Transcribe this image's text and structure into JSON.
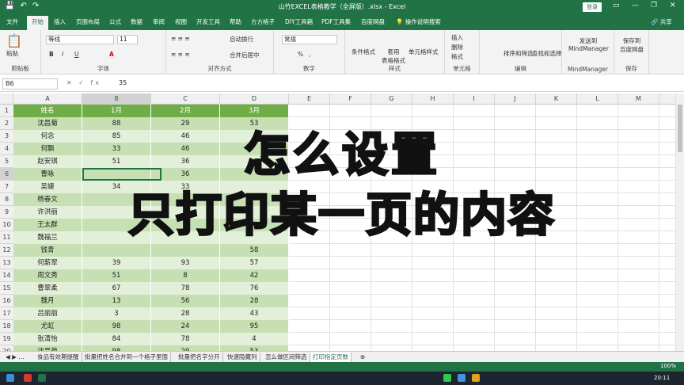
{
  "titlebar": {
    "title": "山竹EXCEL表格教学（全屏版）.xlsx  -  Excel",
    "login": "登录",
    "qat": [
      "💾",
      "↶",
      "↷"
    ],
    "win": [
      "▭",
      "—",
      "❐",
      "✕"
    ]
  },
  "tabs": [
    "文件",
    "开始",
    "插入",
    "页面布局",
    "公式",
    "数据",
    "审阅",
    "视图",
    "开发工具",
    "帮助",
    "方方格子",
    "DIY工具箱",
    "PDF工具集",
    "百度网盘",
    "💡 操作说明搜索"
  ],
  "share": "🔗 共享",
  "ribbon": {
    "clipboard": {
      "label": "剪贴板",
      "paste": "粘贴"
    },
    "font": {
      "label": "字体",
      "name": "等线",
      "size": "11",
      "bold": "B",
      "italic": "I",
      "underline": "U"
    },
    "align": {
      "label": "对齐方式",
      "wrap": "自动换行",
      "merge": "合并后居中"
    },
    "number": {
      "label": "数字",
      "format": "常规",
      "pct": "%",
      "comma": ","
    },
    "styles": {
      "label": "样式",
      "cond": "条件格式",
      "table": "套用\n表格格式",
      "cell": "单元格样式"
    },
    "cells": {
      "label": "单元格",
      "insert": "插入",
      "delete": "删除",
      "format": "格式"
    },
    "edit": {
      "label": "编辑",
      "sort": "排序和筛选",
      "find": "查找和选择"
    },
    "mind": {
      "label": "MindManager",
      "send": "发送到\nMindManager"
    },
    "save": {
      "label": "保存",
      "baidu": "保存到\n百度网盘"
    }
  },
  "formula_bar": {
    "namebox": "B6",
    "fx": "✕  ✓  fx",
    "value": "35"
  },
  "columns": [
    "A",
    "B",
    "C",
    "D",
    "E",
    "F",
    "G",
    "H",
    "I",
    "J",
    "K",
    "L",
    "M"
  ],
  "rows": [
    "1",
    "2",
    "3",
    "4",
    "5",
    "6",
    "7",
    "8",
    "9",
    "10",
    "11",
    "12",
    "13",
    "14",
    "15",
    "16",
    "17",
    "18",
    "19",
    "20"
  ],
  "table": {
    "headers": [
      "姓名",
      "1月",
      "2月",
      "3月"
    ],
    "data": [
      [
        "沈昌菊",
        "88",
        "29",
        "53"
      ],
      [
        "何念",
        "85",
        "46",
        ""
      ],
      [
        "何飘",
        "33",
        "46",
        ""
      ],
      [
        "赵安琪",
        "51",
        "36",
        ""
      ],
      [
        "曹咏",
        "",
        "36",
        ""
      ],
      [
        "吴婕",
        "34",
        "33",
        ""
      ],
      [
        "杨春文",
        "",
        "",
        ""
      ],
      [
        "许洪丽",
        "",
        "",
        ""
      ],
      [
        "王太群",
        "",
        "",
        ""
      ],
      [
        "魏福兰",
        "",
        "",
        ""
      ],
      [
        "钱青",
        "",
        "",
        "58"
      ],
      [
        "何薪翠",
        "39",
        "93",
        "57"
      ],
      [
        "周文秀",
        "51",
        "8",
        "42"
      ],
      [
        "曹翠柔",
        "67",
        "78",
        "76"
      ],
      [
        "魏月",
        "13",
        "56",
        "28"
      ],
      [
        "吕丽丽",
        "3",
        "28",
        "43"
      ],
      [
        "尤虹",
        "98",
        "24",
        "95"
      ],
      [
        "张清怡",
        "84",
        "78",
        "4"
      ],
      [
        "沈昌菊",
        "98",
        "29",
        "53"
      ]
    ]
  },
  "overlay": {
    "line1": "怎么设置",
    "line2": "只打印某一页的内容"
  },
  "sheets": [
    "食品有效期提醒",
    "批量把姓名合并到一个格子里面",
    "批量把名字分开",
    "快速隐藏列",
    "怎么做区间筛选",
    "打印指定页数"
  ],
  "status": {
    "zoom": "100%"
  },
  "clock": "20:11",
  "colors": {
    "excel_green": "#217346",
    "header_green": "#70ad47",
    "band_dark": "#c6dfb3",
    "band_light": "#e2efd9",
    "overlay_yellow": "#f6e000"
  }
}
